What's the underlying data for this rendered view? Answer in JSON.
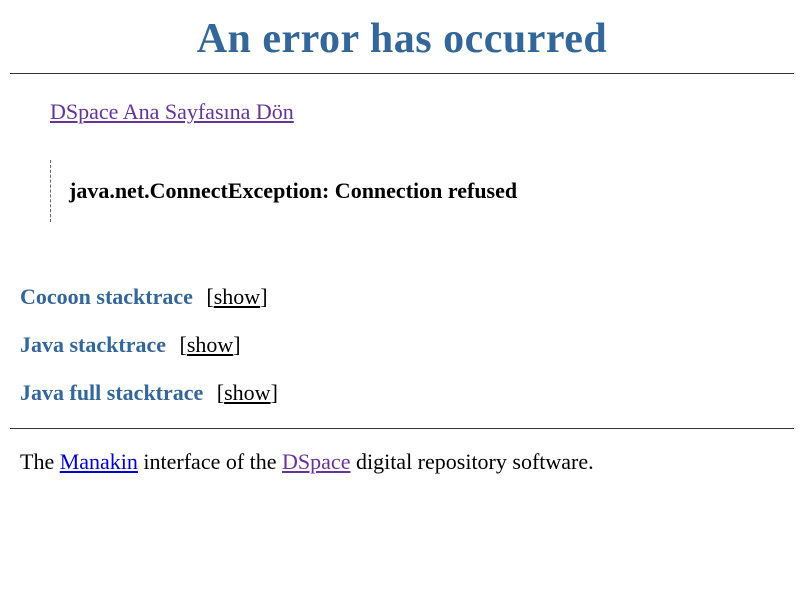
{
  "heading": "An error has occurred",
  "home_link": {
    "label": "DSpace Ana Sayfasına Dön"
  },
  "error_message": "java.net.ConnectException: Connection refused",
  "stacktraces": [
    {
      "label": "Cocoon stacktrace",
      "action": "show"
    },
    {
      "label": "Java stacktrace",
      "action": "show"
    },
    {
      "label": "Java full stacktrace",
      "action": "show"
    }
  ],
  "footer": {
    "prefix": "The ",
    "manakin_label": "Manakin",
    "mid1": " interface of the ",
    "dspace_label": "DSpace",
    "suffix": " digital repository software."
  }
}
